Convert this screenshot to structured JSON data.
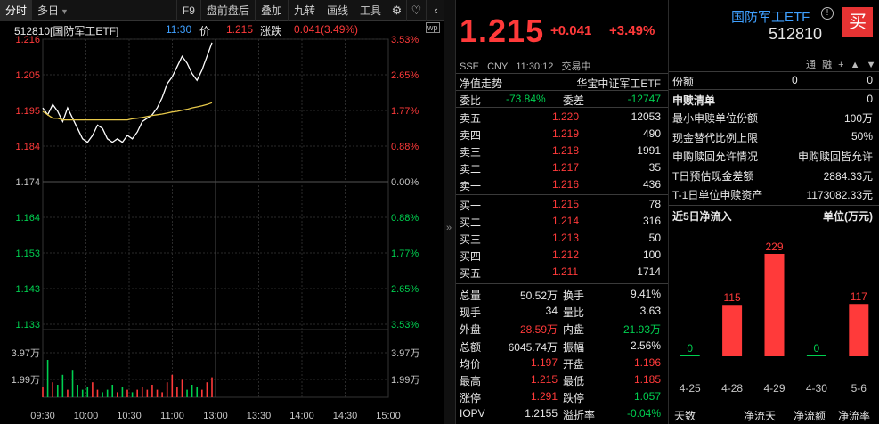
{
  "toolbar": {
    "tabs": [
      "分时",
      "多日"
    ],
    "buttons": [
      "F9",
      "盘前盘后",
      "叠加",
      "九转",
      "画线",
      "工具"
    ],
    "icons": [
      "gear-icon",
      "heart-icon",
      "chevron-left-icon"
    ]
  },
  "infoline": {
    "code_name": "512810[国防军工ETF]",
    "time": "11:30",
    "price_label": "价",
    "price": "1.215",
    "change_label": "涨跌",
    "change": "0.041(3.49%)"
  },
  "chart_data": {
    "type": "line",
    "y_price_ticks": [
      "1.216",
      "1.205",
      "1.195",
      "1.184",
      "1.174",
      "1.164",
      "1.153",
      "1.143",
      "1.133"
    ],
    "y_pct_ticks": [
      "3.53%",
      "2.65%",
      "1.77%",
      "0.88%",
      "0.00%",
      "0.88%",
      "1.77%",
      "2.65%",
      "3.53%"
    ],
    "vol_left_ticks": [
      "3.97万",
      "1.99万"
    ],
    "vol_right_ticks": [
      "3.97万",
      "1.99万"
    ],
    "x_ticks": [
      "09:30",
      "10:00",
      "10:30",
      "11:00",
      "13:00",
      "13:30",
      "14:00",
      "14:30",
      "15:00"
    ],
    "ylim": [
      1.133,
      1.216
    ],
    "prev_close": 1.174,
    "series": [
      {
        "values": [
          1.196,
          1.194,
          1.197,
          1.195,
          1.192,
          1.196,
          1.193,
          1.19,
          1.187,
          1.186,
          1.188,
          1.191,
          1.19,
          1.187,
          1.186,
          1.187,
          1.186,
          1.188,
          1.187,
          1.189,
          1.192,
          1.193,
          1.194,
          1.196,
          1.199,
          1.203,
          1.205,
          1.208,
          1.211,
          1.209,
          1.206,
          1.204,
          1.207,
          1.211,
          1.215
        ]
      },
      {
        "values": [
          1.195,
          1.194,
          1.193,
          1.193,
          1.1925,
          1.1925,
          1.1925,
          1.1925,
          1.1925,
          1.1925,
          1.1925,
          1.1925,
          1.1925,
          1.1925,
          1.1925,
          1.1925,
          1.1925,
          1.1925,
          1.1928,
          1.193,
          1.1932,
          1.1935,
          1.1938,
          1.194,
          1.1942,
          1.1945,
          1.1948,
          1.195,
          1.1953,
          1.1956,
          1.196,
          1.1963,
          1.1966,
          1.197,
          1.1975
        ]
      }
    ],
    "volumes": [
      0.4,
      1.5,
      0.6,
      0.5,
      0.9,
      0.3,
      1.1,
      0.5,
      0.3,
      0.4,
      0.6,
      0.3,
      0.2,
      0.3,
      0.5,
      0.2,
      0.4,
      0.3,
      0.2,
      0.3,
      0.4,
      0.3,
      0.5,
      0.3,
      0.2,
      0.6,
      0.9,
      0.4,
      0.7,
      0.3,
      0.5,
      0.4,
      0.3,
      0.6,
      0.8
    ]
  },
  "quote": {
    "price": "1.215",
    "change": "+0.041",
    "change_pct": "+3.49%",
    "meta": [
      "SSE",
      "CNY",
      "11:30:12",
      "交易中"
    ],
    "nav_label": "净值走势",
    "index_name": "华宝中证军工ETF",
    "weibi_label": "委比",
    "weibi": "-73.84%",
    "weicha_label": "委差",
    "weicha": "-12747",
    "asks": [
      {
        "label": "卖五",
        "price": "1.220",
        "vol": "12053"
      },
      {
        "label": "卖四",
        "price": "1.219",
        "vol": "490"
      },
      {
        "label": "卖三",
        "price": "1.218",
        "vol": "1991"
      },
      {
        "label": "卖二",
        "price": "1.217",
        "vol": "35"
      },
      {
        "label": "卖一",
        "price": "1.216",
        "vol": "436"
      }
    ],
    "bids": [
      {
        "label": "买一",
        "price": "1.215",
        "vol": "78"
      },
      {
        "label": "买二",
        "price": "1.214",
        "vol": "316"
      },
      {
        "label": "买三",
        "price": "1.213",
        "vol": "50"
      },
      {
        "label": "买四",
        "price": "1.212",
        "vol": "100"
      },
      {
        "label": "买五",
        "price": "1.211",
        "vol": "1714"
      }
    ],
    "stats": [
      {
        "l1": "总量",
        "v1": "50.52万",
        "c1": "white",
        "l2": "换手",
        "v2": "9.41%",
        "c2": "white"
      },
      {
        "l1": "现手",
        "v1": "34",
        "c1": "white",
        "l2": "量比",
        "v2": "3.63",
        "c2": "white"
      },
      {
        "l1": "外盘",
        "v1": "28.59万",
        "c1": "red",
        "l2": "内盘",
        "v2": "21.93万",
        "c2": "green"
      },
      {
        "l1": "总额",
        "v1": "6045.74万",
        "c1": "white",
        "l2": "振幅",
        "v2": "2.56%",
        "c2": "white"
      },
      {
        "l1": "均价",
        "v1": "1.197",
        "c1": "red",
        "l2": "开盘",
        "v2": "1.196",
        "c2": "red"
      },
      {
        "l1": "最高",
        "v1": "1.215",
        "c1": "red",
        "l2": "最低",
        "v2": "1.185",
        "c2": "red"
      },
      {
        "l1": "涨停",
        "v1": "1.291",
        "c1": "red",
        "l2": "跌停",
        "v2": "1.057",
        "c2": "green"
      },
      {
        "l1": "IOPV",
        "v1": "1.2155",
        "c1": "white",
        "l2": "溢折率",
        "v2": "-0.04%",
        "c2": "green"
      }
    ]
  },
  "etf": {
    "name": "国防军工ETF",
    "code": "512810",
    "info_glyph": "!",
    "buy_label": "买",
    "tool_labels": [
      "通",
      "融",
      "+",
      "▲",
      "▼"
    ],
    "share_label": "份额",
    "share_v1": "0",
    "share_v2": "0",
    "sg_title": "申赎清单",
    "sg_value": "0",
    "sg_rows": [
      {
        "label": "最小申赎单位份额",
        "value": "100万"
      },
      {
        "label": "现金替代比例上限",
        "value": "50%"
      },
      {
        "label": "申购赎回允许情况",
        "value": "申购赎回皆允许"
      },
      {
        "label": "T日预估现金差额",
        "value": "2884.33元"
      },
      {
        "label": "T-1日单位申赎资产",
        "value": "1173082.33元"
      }
    ],
    "flow_title": "近5日净流入",
    "flow_unit": "单位(万元)",
    "flow_dates": [
      "4-25",
      "4-28",
      "4-29",
      "4-30",
      "5-6"
    ],
    "flow_values": [
      0,
      115,
      229,
      0,
      117
    ],
    "flow_value_labels": [
      "0",
      "115",
      "229",
      "0",
      "117"
    ],
    "footer": [
      "天数",
      "净流天",
      "净流额",
      "净流率"
    ]
  },
  "colors": {
    "up": "#ff3a3a",
    "down": "#00d050",
    "accent": "#3fa0ff",
    "buy": "#e63333"
  }
}
